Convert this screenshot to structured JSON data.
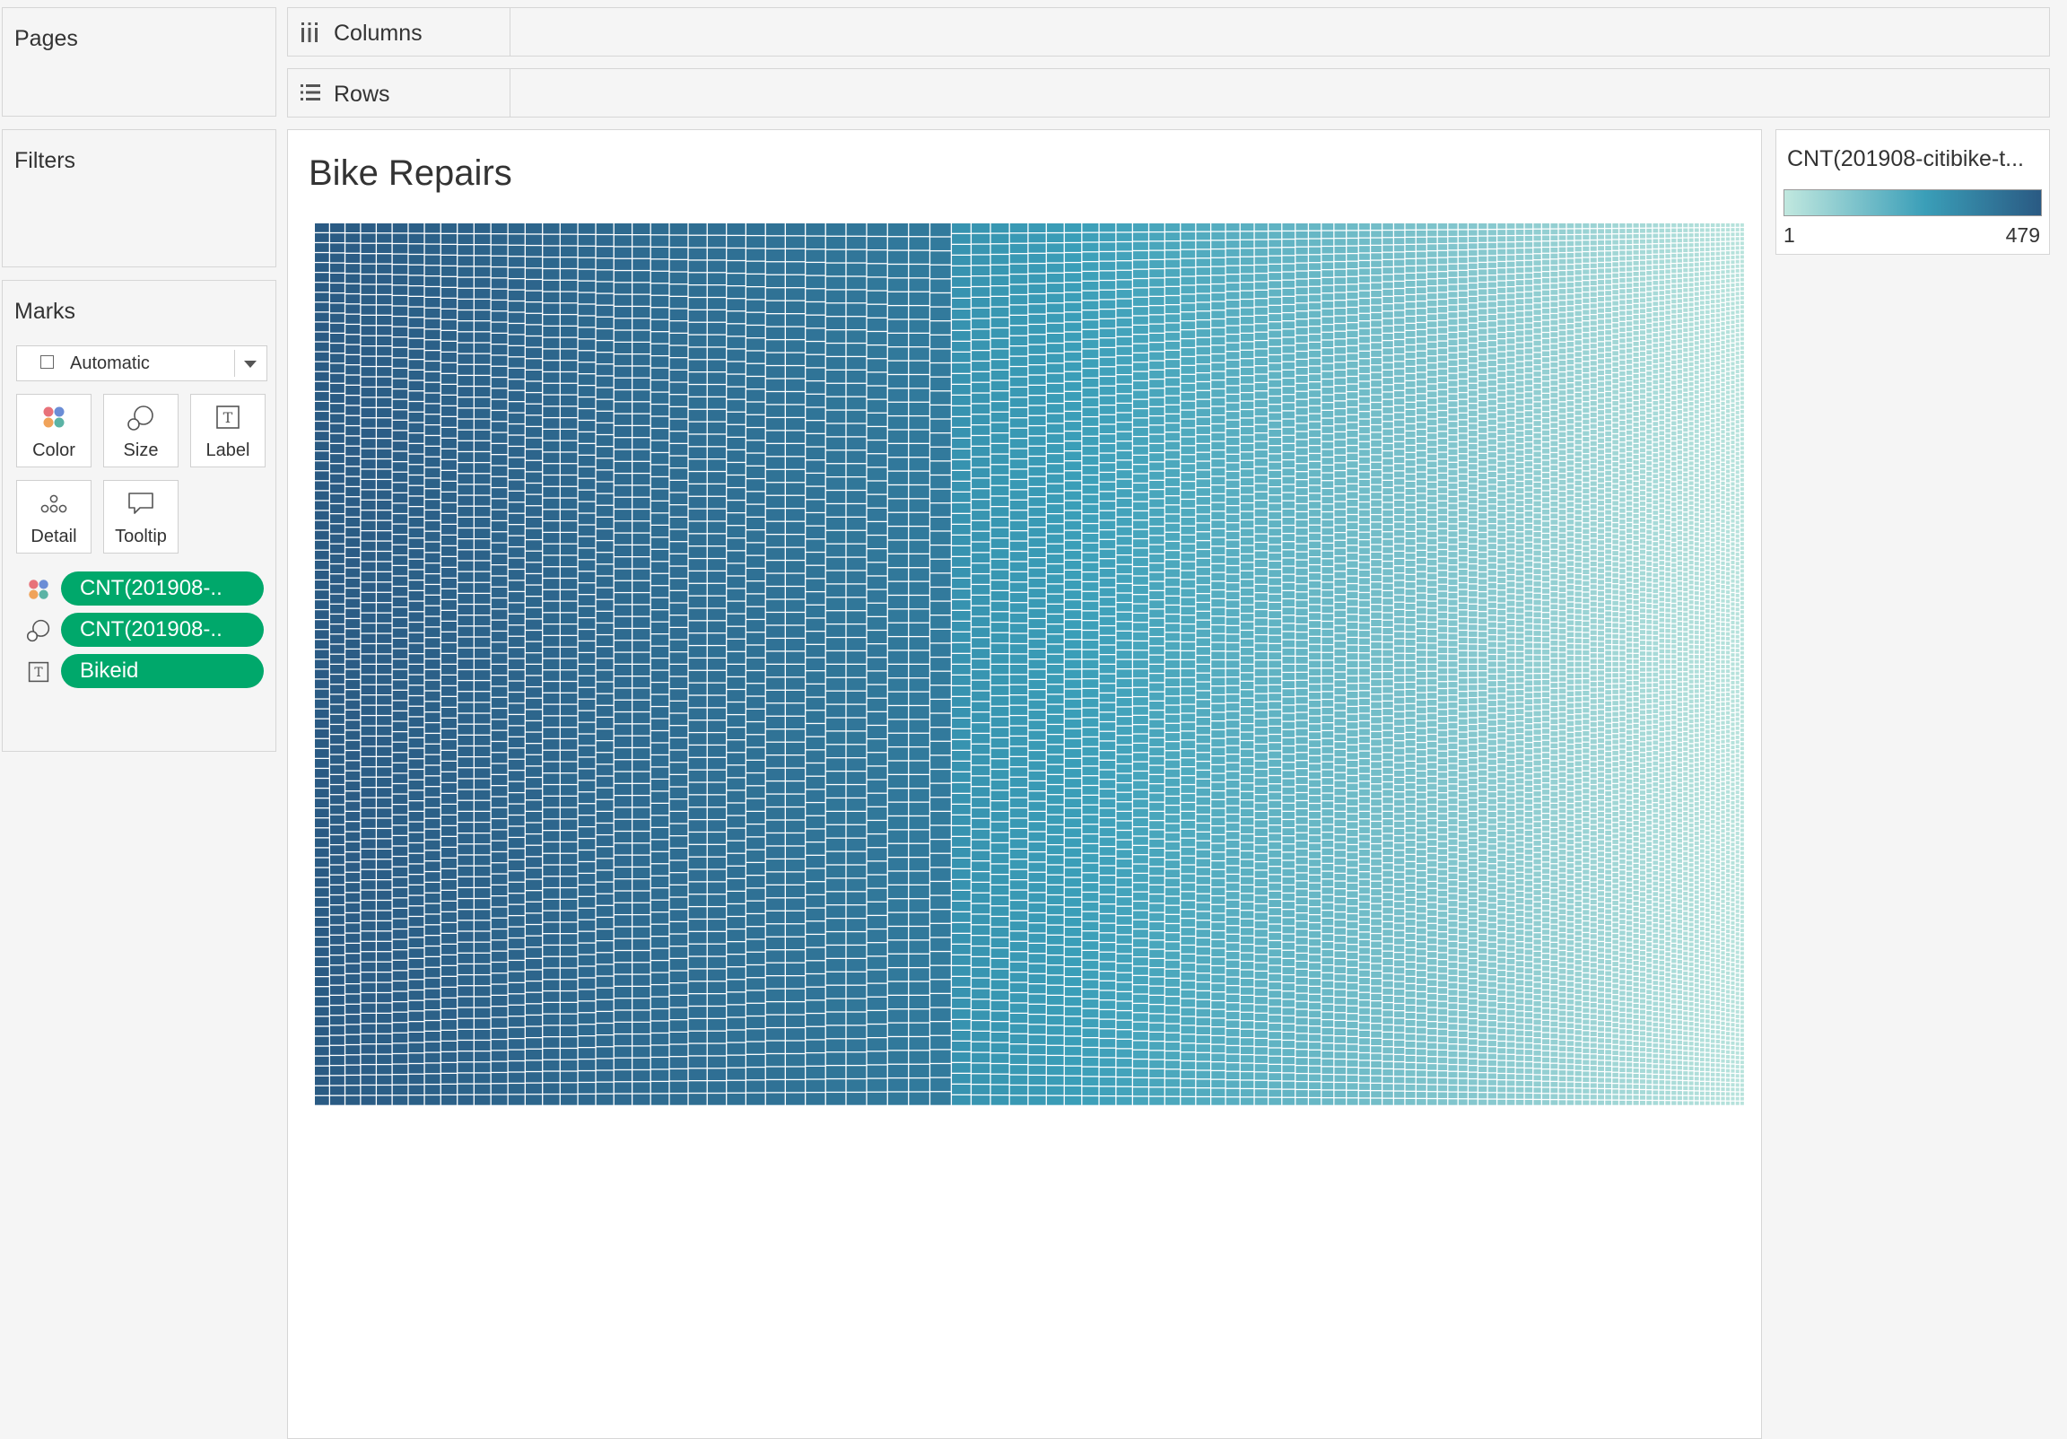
{
  "pages": {
    "title": "Pages"
  },
  "filters": {
    "title": "Filters"
  },
  "marks": {
    "title": "Marks",
    "mark_type": "Automatic",
    "buttons": {
      "color": "Color",
      "size": "Size",
      "label": "Label",
      "detail": "Detail",
      "tooltip": "Tooltip"
    },
    "pills": [
      {
        "encoding": "color",
        "field": "CNT(201908-.."
      },
      {
        "encoding": "size",
        "field": "CNT(201908-.."
      },
      {
        "encoding": "label",
        "field": "Bikeid"
      }
    ]
  },
  "shelves": {
    "columns": "Columns",
    "rows": "Rows"
  },
  "viz": {
    "title": "Bike Repairs"
  },
  "legend": {
    "title": "CNT(201908-citibike-t...",
    "min": "1",
    "max": "479",
    "color_low": "#c1e8df",
    "color_mid": "#3a9eb8",
    "color_high": "#2a5a83"
  },
  "colors": {
    "pill": "#00a86b",
    "icon_pink": "#e8727a",
    "icon_blue": "#6b8dd6",
    "icon_orange": "#f0a35a",
    "icon_teal": "#5bb3a5"
  },
  "chart_data": {
    "type": "treemap",
    "title": "Bike Repairs",
    "size_and_color_field": "CNT(201908-citibike-t...",
    "label_field": "Bikeid",
    "value_range": [
      1,
      479
    ]
  }
}
